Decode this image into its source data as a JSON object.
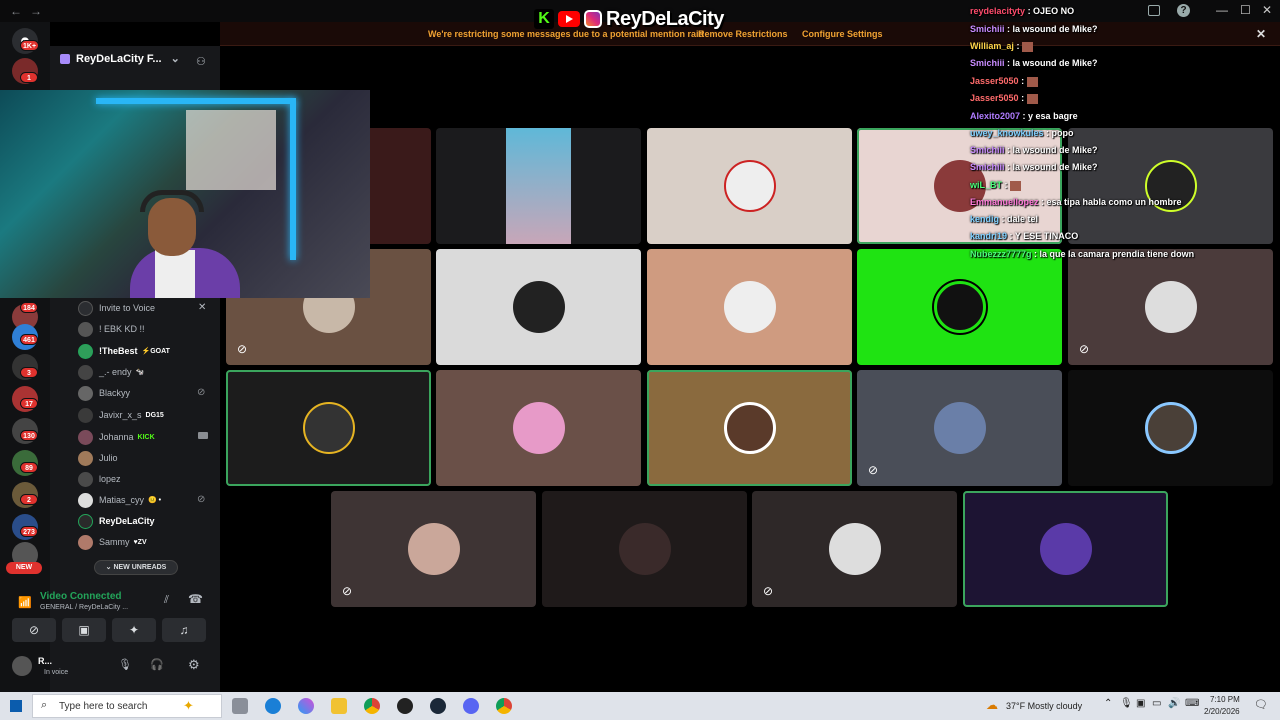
{
  "titlebar": {
    "nav_back": "←",
    "nav_forward": "→"
  },
  "overlay_logo": {
    "channel": "ReyDeLaCity",
    "kick_letter": "K"
  },
  "banner": {
    "message": "We're restricting some messages due to a potential mention raid",
    "remove": "Remove Restrictions",
    "configure": "Configure Settings",
    "close": "✕"
  },
  "window_controls": {
    "minimize": "—",
    "maximize": "☐",
    "close": "✕"
  },
  "server_rail": {
    "badges": [
      "1K+",
      "1",
      "184",
      "461",
      "3",
      "17",
      "130",
      "89",
      "2",
      "273"
    ],
    "new_label": "NEW"
  },
  "channel_panel": {
    "server_name": "ReyDeLaCity F...",
    "invite": "Invite to Voice",
    "members": [
      {
        "name": "! EBK KD !!",
        "tag": ""
      },
      {
        "name": "!TheBest",
        "tag": "⚡GOAT"
      },
      {
        "name": "_.- endy",
        "tag": "🐄"
      },
      {
        "name": "Blackyy",
        "tag": ""
      },
      {
        "name": "Javixr_x_s",
        "tag": "DG15"
      },
      {
        "name": "Johanna",
        "tag": "KICK"
      },
      {
        "name": "Julio",
        "tag": ""
      },
      {
        "name": "lopez",
        "tag": ""
      },
      {
        "name": "Matias_cyy",
        "tag": "😐 •"
      },
      {
        "name": "ReyDeLaCity",
        "tag": ""
      },
      {
        "name": "Sammy",
        "tag": "♥ZV"
      }
    ],
    "new_unreads": "NEW UNREADS"
  },
  "voice": {
    "status": "Video Connected",
    "channel": "GENERAL / ReyDeLaCity ...",
    "user": "R...",
    "user_status": "In voice"
  },
  "colors": {
    "accent_green": "#23a55a",
    "banner_text": "#f0a232",
    "discord_green": "#1fe312",
    "selected_outline": "#3ba55d"
  },
  "chat": [
    {
      "user": "reydelacityty",
      "msg": ": OJEO NO",
      "color": "#ff4d6d"
    },
    {
      "user": "Smichiii",
      "msg": ": la wsound de Mike?",
      "color": "#c88bff"
    },
    {
      "user": "William_aj",
      "msg": ":",
      "color": "#ffd54a"
    },
    {
      "user": "Smichiii",
      "msg": ": la wsound de Mike?",
      "color": "#c88bff"
    },
    {
      "user": "Jasser5050",
      "msg": ":",
      "color": "#ff6b6b"
    },
    {
      "user": "Jasser5050",
      "msg": ":",
      "color": "#ff6b6b"
    },
    {
      "user": "Alexito2007",
      "msg": ": y esa bagre",
      "color": "#b07cff"
    },
    {
      "user": "uwey_knowkules",
      "msg": ": popo",
      "color": "#7fd0ff"
    },
    {
      "user": "Smichiii",
      "msg": ": la wsound de Mike?",
      "color": "#c88bff"
    },
    {
      "user": "Smichiii",
      "msg": ": la wsound de Mike?",
      "color": "#c88bff"
    },
    {
      "user": "wiL_BT",
      "msg": ":",
      "color": "#4aff7a"
    },
    {
      "user": "Emmanuellopez",
      "msg": ": esa tipa habla como un hombre",
      "color": "#ff7ad9"
    },
    {
      "user": "kendig",
      "msg": ": dale tel",
      "color": "#7fd0ff"
    },
    {
      "user": "kandri19",
      "msg": ": Y ESE TINACO",
      "color": "#7fd0ff"
    },
    {
      "user": "Nubezzz7777g",
      "msg": ": la que la camara prendia tiene down",
      "color": "#4aff7a"
    }
  ],
  "taskbar": {
    "search_placeholder": "Type here to search",
    "weather": "37°F  Mostly cloudy",
    "time": "7:10 PM",
    "date": "2/20/2026"
  }
}
